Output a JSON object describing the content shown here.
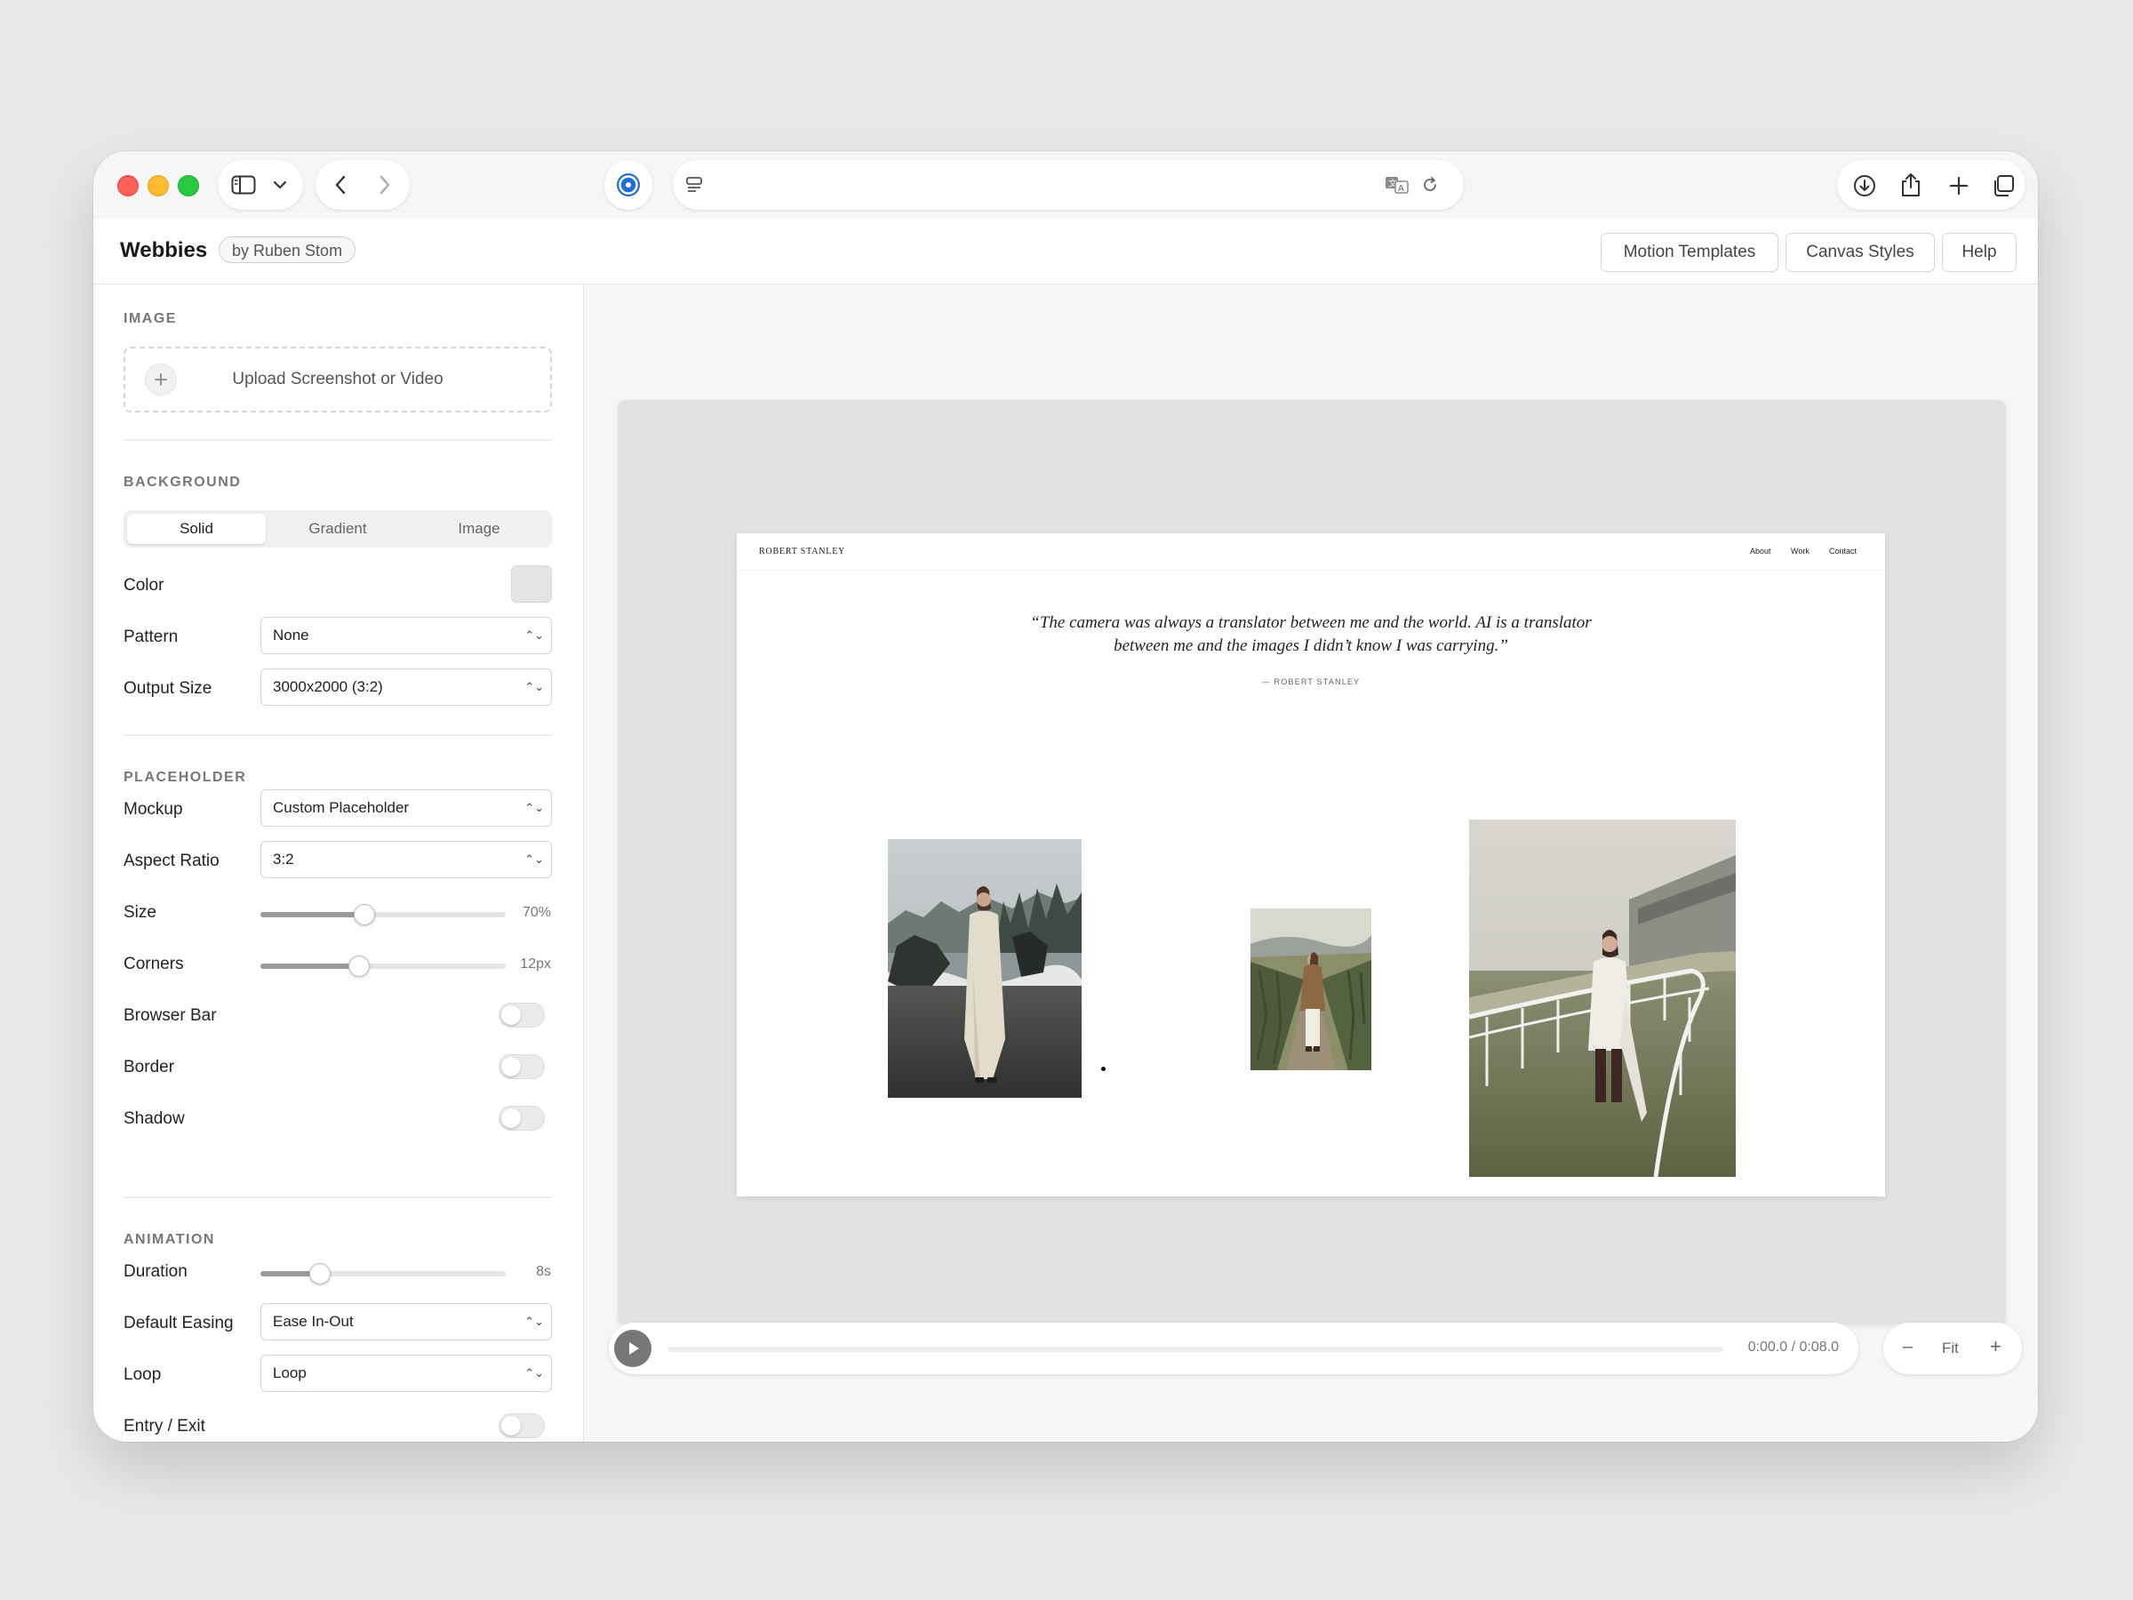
{
  "browser": {
    "address": "",
    "icons": [
      "sidebar-icon",
      "chevron-down-icon",
      "back-icon",
      "forward-icon",
      "safari-icon",
      "page-menu-icon",
      "translate-icon",
      "reload-icon",
      "download-icon",
      "share-icon",
      "new-tab-icon",
      "tabs-icon"
    ]
  },
  "app": {
    "name": "Webbies",
    "author_badge": "by Ruben Stom",
    "nav": [
      "Motion Templates",
      "Canvas Styles",
      "Help"
    ]
  },
  "sidebar": {
    "image": {
      "section": "IMAGE",
      "upload_label": "Upload Screenshot or Video"
    },
    "background": {
      "section": "BACKGROUND",
      "tabs": [
        "Solid",
        "Gradient",
        "Image"
      ],
      "active_tab": "Solid",
      "color_label": "Color",
      "color_value": "#e4e4e4",
      "pattern_label": "Pattern",
      "pattern_value": "None",
      "output_label": "Output Size",
      "output_value": "3000x2000 (3:2)"
    },
    "placeholder": {
      "section": "PLACEHOLDER",
      "mockup_label": "Mockup",
      "mockup_value": "Custom Placeholder",
      "aspect_label": "Aspect Ratio",
      "aspect_value": "3:2",
      "size_label": "Size",
      "size_value": "70%",
      "size_fraction": 0.42,
      "corners_label": "Corners",
      "corners_value": "12px",
      "corners_fraction": 0.4,
      "browser_bar_label": "Browser Bar",
      "browser_bar_on": false,
      "border_label": "Border",
      "border_on": false,
      "shadow_label": "Shadow",
      "shadow_on": false
    },
    "animation": {
      "section": "ANIMATION",
      "duration_label": "Duration",
      "duration_value": "8s",
      "duration_fraction": 0.24,
      "easing_label": "Default Easing",
      "easing_value": "Ease In-Out",
      "loop_label": "Loop",
      "loop_value": "Loop",
      "entry_label": "Entry / Exit"
    }
  },
  "preview": {
    "site_name": "ROBERT STANLEY",
    "nav": [
      "About",
      "Work",
      "Contact"
    ],
    "quote": "“The camera was always a translator between me and the world. AI is a translator between me and the images I didn’t know I was carrying.”",
    "attribution": "— ROBERT STANLEY"
  },
  "player": {
    "time": "0:00.0 / 0:08.0",
    "progress": 0,
    "zoom_minus": "–",
    "zoom_label": "Fit",
    "zoom_plus": "+"
  },
  "colors": {
    "accent_blue": "#1f6fd6",
    "traffic_red": "#ff5f57",
    "traffic_yellow": "#febc2e",
    "traffic_green": "#28c840"
  }
}
